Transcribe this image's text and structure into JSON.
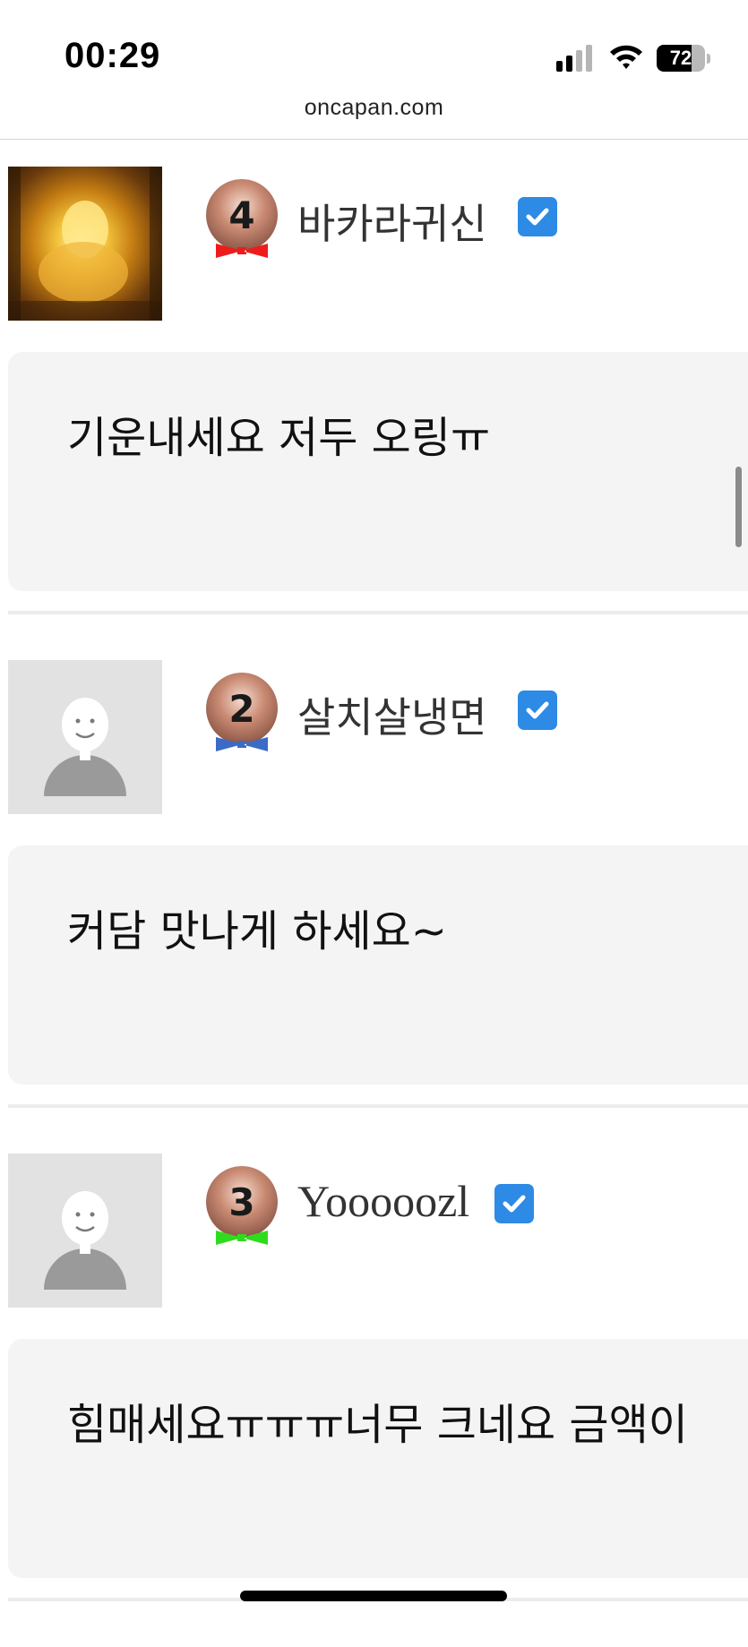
{
  "status_bar": {
    "time": "00:29",
    "battery_level": "72",
    "battery_fraction": 0.72,
    "signal_bars_active": 2,
    "signal_bars_total": 4,
    "icons": [
      "cellular-signal-icon",
      "wifi-icon",
      "battery-icon"
    ]
  },
  "browser": {
    "url": "oncapan.com"
  },
  "comments": [
    {
      "avatar": "buddha-statue-photo",
      "level": "4",
      "tie_color": "#ee1c1c",
      "nickname": "바카라귀신",
      "verified": true,
      "text": "기운내세요 저두 오링ㅠ"
    },
    {
      "avatar": "default-user-avatar",
      "level": "2",
      "tie_color": "#3a6cc7",
      "nickname": "살치살냉면",
      "verified": true,
      "text": "커담 맛나게 하세요~"
    },
    {
      "avatar": "default-user-avatar",
      "level": "3",
      "tie_color": "#2fdc1d",
      "nickname": "Yoooooz​l",
      "verified": true,
      "text": "힘매세요ㅠㅠㅠ너무 크네요 금액이"
    }
  ],
  "colors": {
    "verified_blue": "#2d8ae5",
    "bubble_bg": "#f4f4f4",
    "separator": "#ececec"
  }
}
